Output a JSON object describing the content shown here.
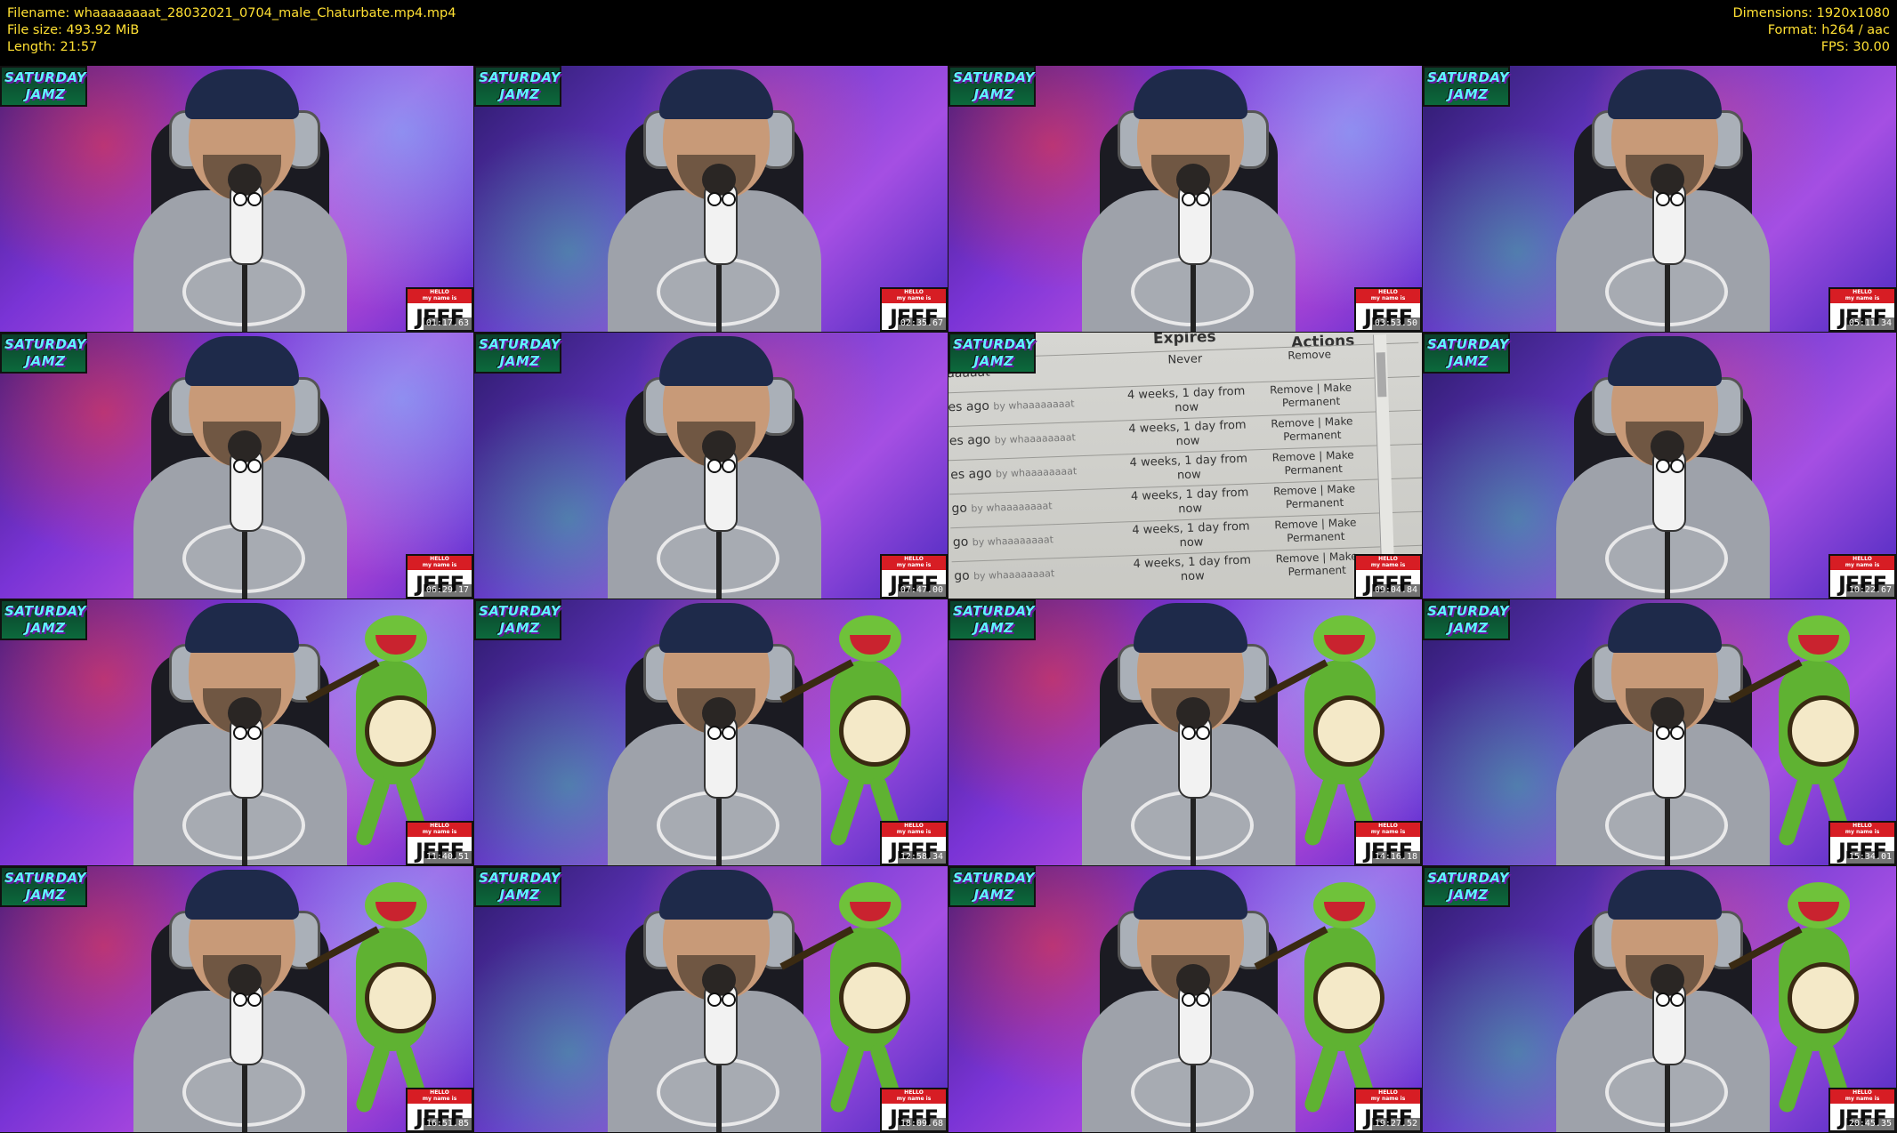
{
  "header": {
    "filename": "Filename: whaaaaaaaat_28032021_0704_male_Chaturbate.mp4.mp4",
    "filesize": "File size: 493.92 MiB",
    "length": "Length: 21:57",
    "dimensions": "Dimensions: 1920x1080",
    "format": "Format: h264 / aac",
    "fps": "FPS: 30.00"
  },
  "overlay": {
    "badge_line1": "SATURDAY",
    "badge_line2": "JAMZ",
    "tag_top_line1": "HELLO",
    "tag_top_line2": "my name is",
    "tag_name": "JEFF"
  },
  "thumbnails": [
    {
      "time": "01:17.63"
    },
    {
      "time": "02:35.67"
    },
    {
      "time": "03:53.50"
    },
    {
      "time": "05:11.34"
    },
    {
      "time": "06:29.17"
    },
    {
      "time": "07:47.00"
    },
    {
      "time": "09:04.84"
    },
    {
      "time": "10:22.67"
    },
    {
      "time": "11:40.51"
    },
    {
      "time": "12:58.34"
    },
    {
      "time": "14:16.18"
    },
    {
      "time": "15:34.01"
    },
    {
      "time": "16:51.85"
    },
    {
      "time": "18:09.68"
    },
    {
      "time": "19:27.52"
    },
    {
      "time": "20:45.35"
    }
  ],
  "screen_table": {
    "col_expires": "Expires",
    "col_actions": "Actions",
    "rows": [
      {
        "left": "aaaaat",
        "by": "",
        "expires": "Never",
        "actions": "Remove"
      },
      {
        "left": "es ago",
        "by": "by whaaaaaaaat",
        "expires": "4 weeks, 1 day from now",
        "actions": "Remove | Make Permanent"
      },
      {
        "left": "es ago",
        "by": "by whaaaaaaaat",
        "expires": "4 weeks, 1 day from now",
        "actions": "Remove | Make Permanent"
      },
      {
        "left": "es ago",
        "by": "by whaaaaaaaat",
        "expires": "4 weeks, 1 day from now",
        "actions": "Remove | Make Permanent"
      },
      {
        "left": "go",
        "by": "by whaaaaaaaat",
        "expires": "4 weeks, 1 day from now",
        "actions": "Remove | Make Permanent"
      },
      {
        "left": "go",
        "by": "by whaaaaaaaat",
        "expires": "4 weeks, 1 day from now",
        "actions": "Remove | Make Permanent"
      },
      {
        "left": "go",
        "by": "by whaaaaaaaat",
        "expires": "4 weeks, 1 day from now",
        "actions": "Remove | Make Permanent"
      }
    ]
  }
}
